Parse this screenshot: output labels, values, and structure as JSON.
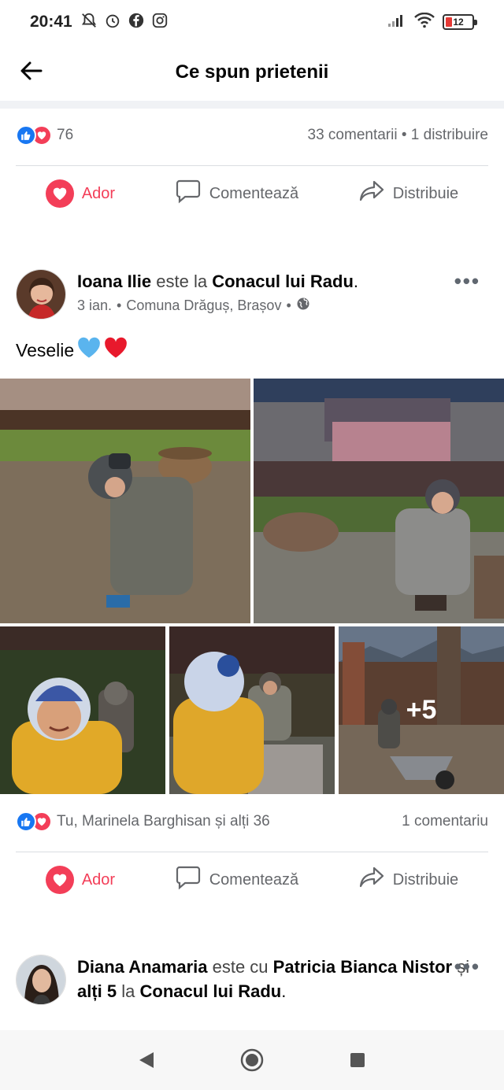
{
  "status_bar": {
    "time": "20:41",
    "battery": "12"
  },
  "header": {
    "title": "Ce spun prietenii"
  },
  "prev_post": {
    "reaction_count": "76",
    "comments_shares": "33 comentarii • 1 distribuire"
  },
  "actions": {
    "love": "Ador",
    "comment": "Comentează",
    "share": "Distribuie"
  },
  "post1": {
    "author": "Ioana Ilie",
    "verb": "este la",
    "place": "Conacul lui Radu",
    "date": "3 ian.",
    "location": "Comuna Drăguș, Brașov",
    "text": "Veselie",
    "more_photos": "+5",
    "reactions_summary": "Tu, Marinela Barghisan și alți 36",
    "comments": "1 comentariu"
  },
  "post2": {
    "author": "Diana Anamaria",
    "verb_with": "este cu",
    "tagged": "Patricia Bianca Nistor",
    "and": "și",
    "others": "alți 5",
    "verb_at": "la",
    "place": "Conacul lui Radu"
  },
  "colors": {
    "like_blue": "#1877f2",
    "love_red": "#f33e58",
    "muted": "#65676b"
  }
}
